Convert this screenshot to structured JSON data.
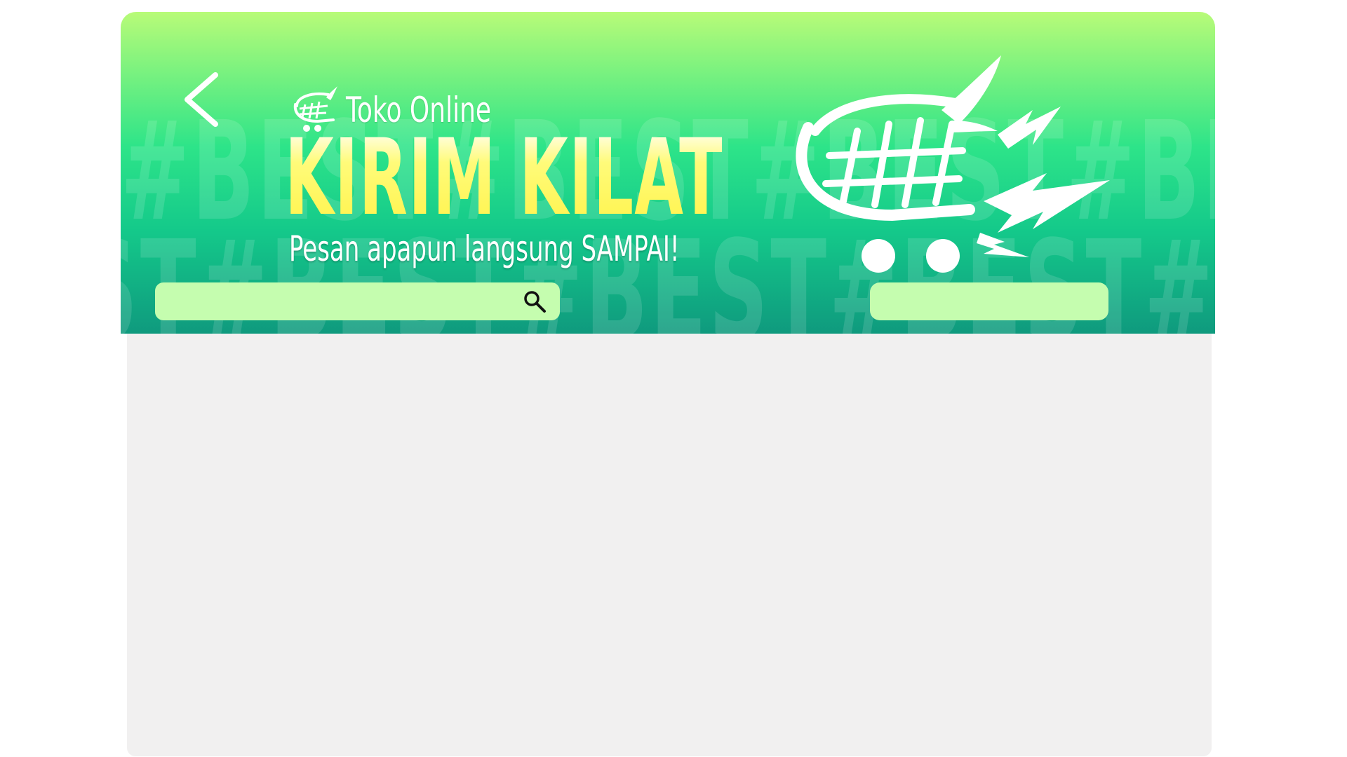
{
  "header": {
    "brand_name": "Toko Online",
    "headline": "KIRIM KILAT",
    "tagline": "Pesan apapun langsung SAMPAI!",
    "background_pattern": "#BEST#BEST#BEST#BEST#BEST#BEST#BEST",
    "background_pattern_2": "ST#BEST#BEST#BEST#BEST#BEST#BEST#B"
  },
  "icons": {
    "back": "chevron-left-icon",
    "brand": "cart-logo-icon",
    "hero": "cart-lightning-icon",
    "search": "search-icon"
  },
  "search": {
    "placeholder": "",
    "value": ""
  },
  "right_box": {
    "label": ""
  },
  "colors": {
    "banner_top": "#b8fb78",
    "banner_mid": "#2de489",
    "banner_bottom": "#0f9a7e",
    "headline": "#fff34a",
    "input_bg": "#c5fdaf",
    "content_bg": "#f1f0f0"
  }
}
